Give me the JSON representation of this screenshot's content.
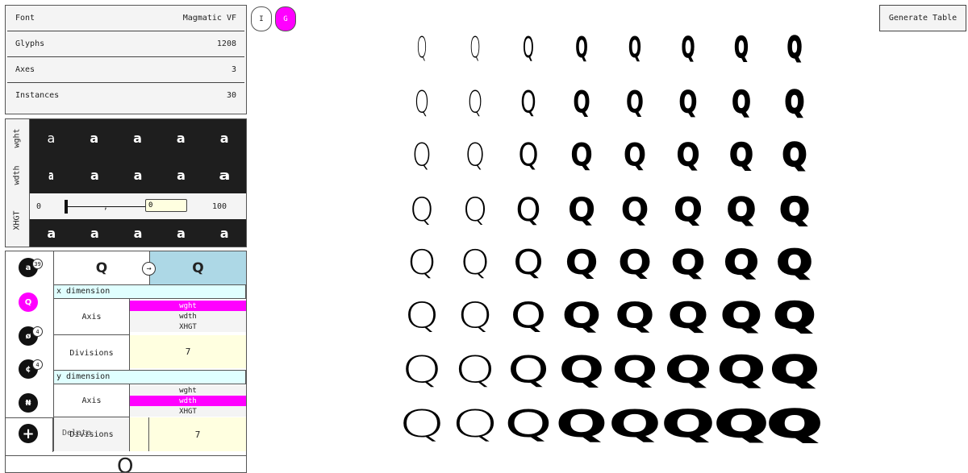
{
  "font_info": [
    {
      "label": "Font",
      "value": "Magmatic VF"
    },
    {
      "label": "Glyphs",
      "value": "1208"
    },
    {
      "label": "Axes",
      "value": "3"
    },
    {
      "label": "Instances",
      "value": "30"
    }
  ],
  "toggles": {
    "i_label": "I",
    "g_label": "G"
  },
  "generate_label": "Generate Table",
  "axes": [
    {
      "name": "wght",
      "glyph": "a"
    },
    {
      "name": "wdth",
      "glyph": "a"
    },
    {
      "name": "XHGT",
      "glyph": "a",
      "slider": {
        "min": "0",
        "max": "100",
        "value": "0",
        "tick": ","
      }
    }
  ],
  "glyph_list": {
    "items": [
      {
        "glyph": "a",
        "count": "39"
      },
      {
        "glyph": "Q",
        "count": ""
      },
      {
        "glyph": "ø",
        "count": "4"
      },
      {
        "glyph": "¢",
        "count": "4"
      },
      {
        "glyph": "₦",
        "count": ""
      }
    ],
    "add_symbol": "+"
  },
  "table": {
    "from_glyph": "Q",
    "arrow": "→",
    "to_glyph": "Q",
    "x_header": "x dimension",
    "y_header": "y dimension",
    "axis_label": "Axis",
    "divisions_label": "Divisions",
    "axis_options": [
      "wght",
      "wdth",
      "XHGT"
    ],
    "x_selected": "wght",
    "y_selected": "wdth",
    "x_divisions": "7",
    "y_divisions": "7",
    "delete_label": "Delete"
  },
  "grid": {
    "glyph": "Q",
    "columns": 8,
    "rows": 8
  },
  "accent": "#ff00ff",
  "highlight": "#add8e6",
  "cream": "#ffffe0"
}
